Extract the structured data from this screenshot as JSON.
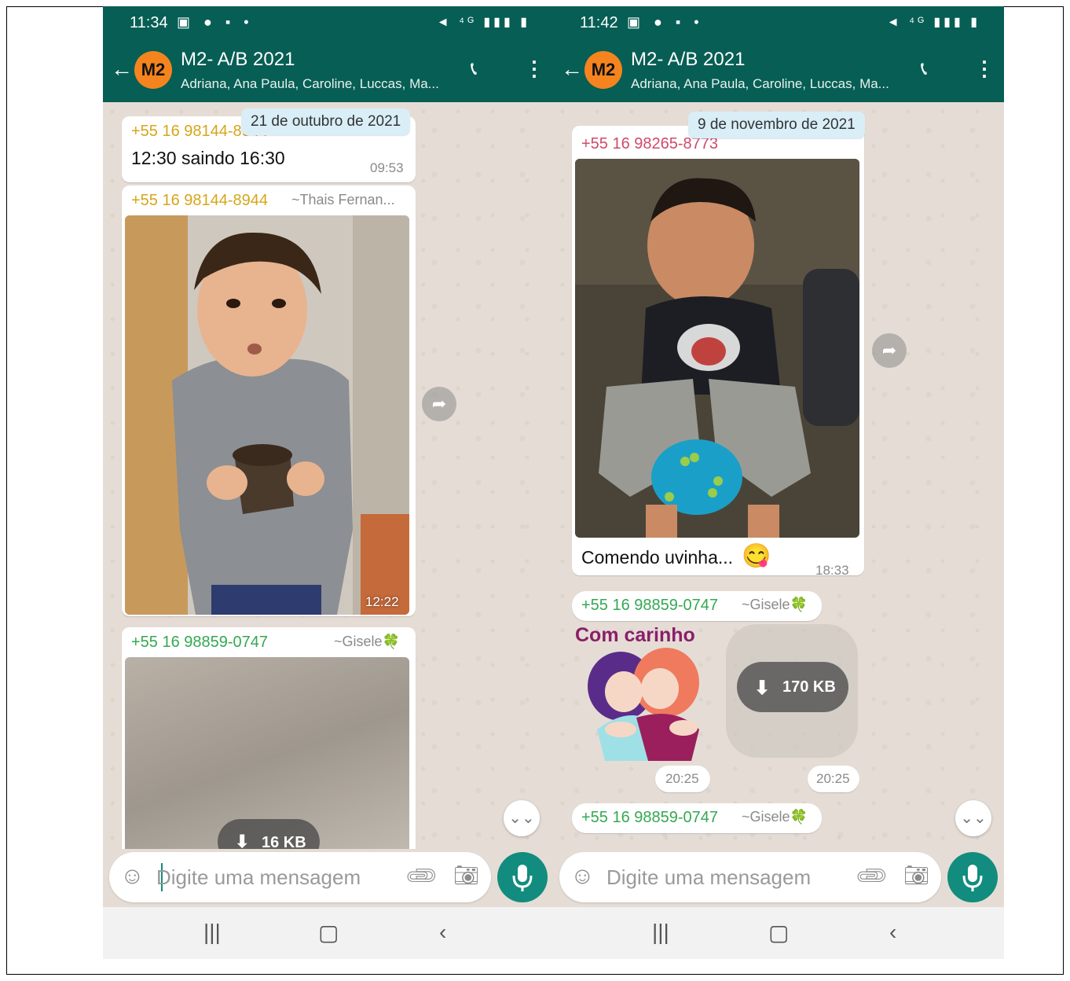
{
  "left": {
    "status": {
      "time": "11:34"
    },
    "header": {
      "avatar": "M2",
      "title": "M2- A/B 2021",
      "subtitle": "Adriana, Ana Paula, Caroline, Luccas, Ma..."
    },
    "date_pill": "21 de outubro de 2021",
    "msg1": {
      "sender": "+55 16 98144-8944",
      "text": "12:30 saindo 16:30",
      "time": "09:53"
    },
    "msg2": {
      "sender": "+55 16 98144-8944",
      "alias": "~Thais Fernan...",
      "time": "12:22"
    },
    "msg3": {
      "sender": "+55 16 98859-0747",
      "alias": "~Gisele🍀",
      "download": "16 KB"
    },
    "input_placeholder": "Digite uma mensagem"
  },
  "right": {
    "status": {
      "time": "11:42"
    },
    "header": {
      "avatar": "M2",
      "title": "M2- A/B 2021",
      "subtitle": "Adriana, Ana Paula, Caroline, Luccas, Ma..."
    },
    "date_pill": "9 de novembro de 2021",
    "msg1": {
      "sender": "+55 16 98265-8773",
      "text": "Comendo uvinha...",
      "time": "18:33"
    },
    "msg2": {
      "sender": "+55 16 98859-0747",
      "alias": "~Gisele🍀",
      "sticker_caption": "Com carinho",
      "time_a": "20:25",
      "time_b": "20:25",
      "download": "170 KB"
    },
    "msg3": {
      "sender": "+55 16 98859-0747",
      "alias": "~Gisele🍀"
    },
    "input_placeholder": "Digite uma mensagem"
  },
  "colors": {
    "header": "#075e54",
    "accent": "#128c7e",
    "chat_bg": "#e5ddd5",
    "sender_yellow": "#d6a61a",
    "sender_green": "#35a852"
  },
  "icons": [
    "back-arrow-icon",
    "add-call-icon",
    "more-vert-icon",
    "emoji-icon",
    "attach-icon",
    "camera-icon",
    "mic-icon",
    "forward-icon",
    "scroll-down-icon",
    "download-icon",
    "recent-apps-icon",
    "home-icon",
    "nav-back-icon"
  ]
}
